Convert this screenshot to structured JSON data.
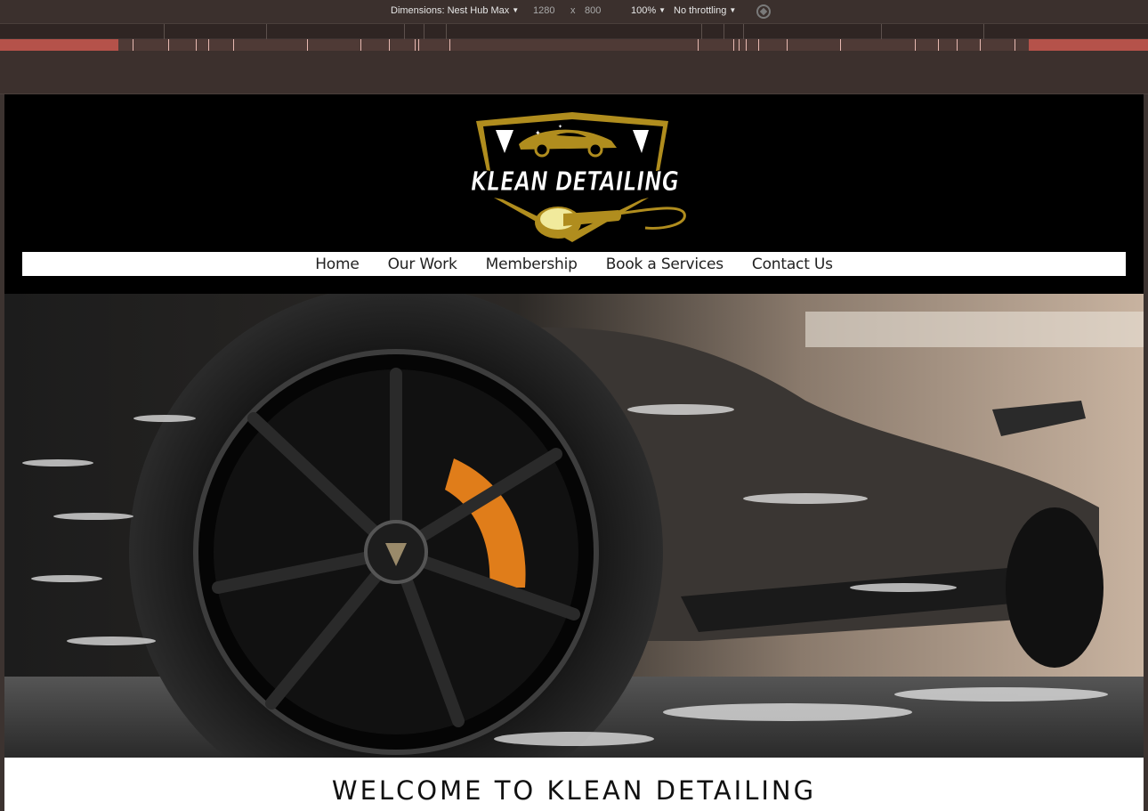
{
  "devtools": {
    "dimensions_label": "Dimensions: Nest Hub Max",
    "width": "1280",
    "times": "x",
    "height": "800",
    "zoom": "100%",
    "throttling": "No throttling"
  },
  "site": {
    "logo_text": "KLEAN DETAILING",
    "nav": [
      "Home",
      "Our Work",
      "Membership",
      "Book a Services",
      "Contact Us"
    ],
    "welcome_heading": "WELCOME TO KLEAN DETAILING"
  },
  "colors": {
    "header_bg": "#000000",
    "logo_gold": "#b08d1e",
    "toolbar_bg": "#3b302d",
    "ruler_red": "#b5524a"
  }
}
